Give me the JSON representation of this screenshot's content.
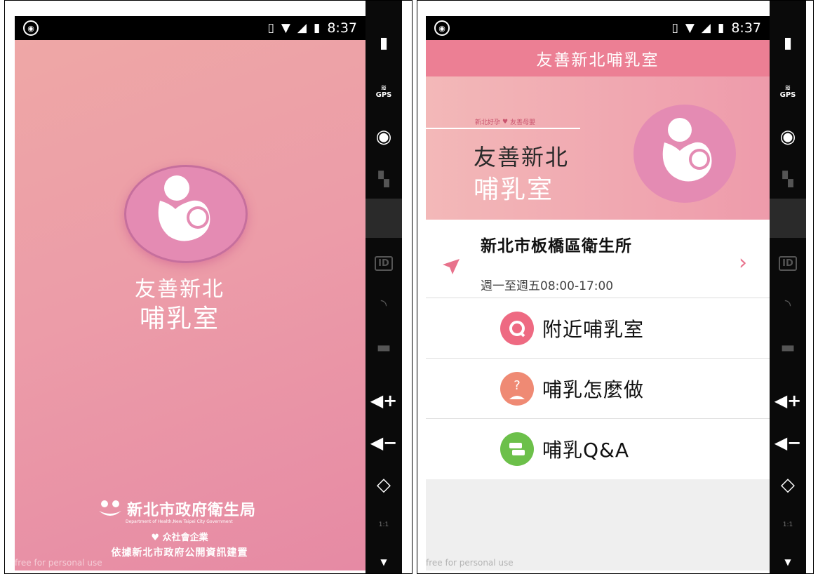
{
  "colors": {
    "pink_accent": "#ec7f94",
    "splash_pink": "#ec9ca8",
    "logo_magenta": "#e48bb3",
    "nearby_icon": "#ee6a82",
    "howto_icon": "#ef8a74",
    "qa_icon": "#6cc04a"
  },
  "left": {
    "statusbar": {
      "time": "8:37"
    },
    "splash": {
      "title_line1": "友善新北",
      "title_line2": "哺乳室",
      "org_name": "新北市政府衛生局",
      "org_en": "Department of Health,New Taipei City Government",
      "partner": "众社會企業",
      "data_basis": "依據新北市政府公開資訊建置",
      "watermark": "free for personal use"
    }
  },
  "right": {
    "statusbar": {
      "time": "8:37"
    },
    "appbar": {
      "title": "友善新北哺乳室"
    },
    "banner": {
      "slogan_left": "新北好孕",
      "slogan_right": "友善母嬰",
      "title_line1": "友善新北",
      "title_line2": "哺乳室"
    },
    "location": {
      "name": "新北市板橋區衛生所",
      "hours": "週一至週五08:00-17:00"
    },
    "menu": [
      {
        "label": "附近哺乳室",
        "icon": "search-icon"
      },
      {
        "label": "哺乳怎麼做",
        "icon": "question-person-icon"
      },
      {
        "label": "哺乳Q&A",
        "icon": "chat-bubble-icon"
      }
    ],
    "watermark": "free for personal use"
  },
  "toolbar": {
    "items": [
      "battery-icon",
      "gps-icon",
      "webcam-icon",
      "clapper-icon",
      "dpad-icon",
      "id-icon",
      "rss-icon",
      "sms-icon",
      "volume-up-icon",
      "volume-down-icon",
      "rotate-icon",
      "scale-icon",
      "dropdown-icon"
    ],
    "gps_label": "GPS",
    "id_label": "ID",
    "scale_label": "1:1"
  }
}
